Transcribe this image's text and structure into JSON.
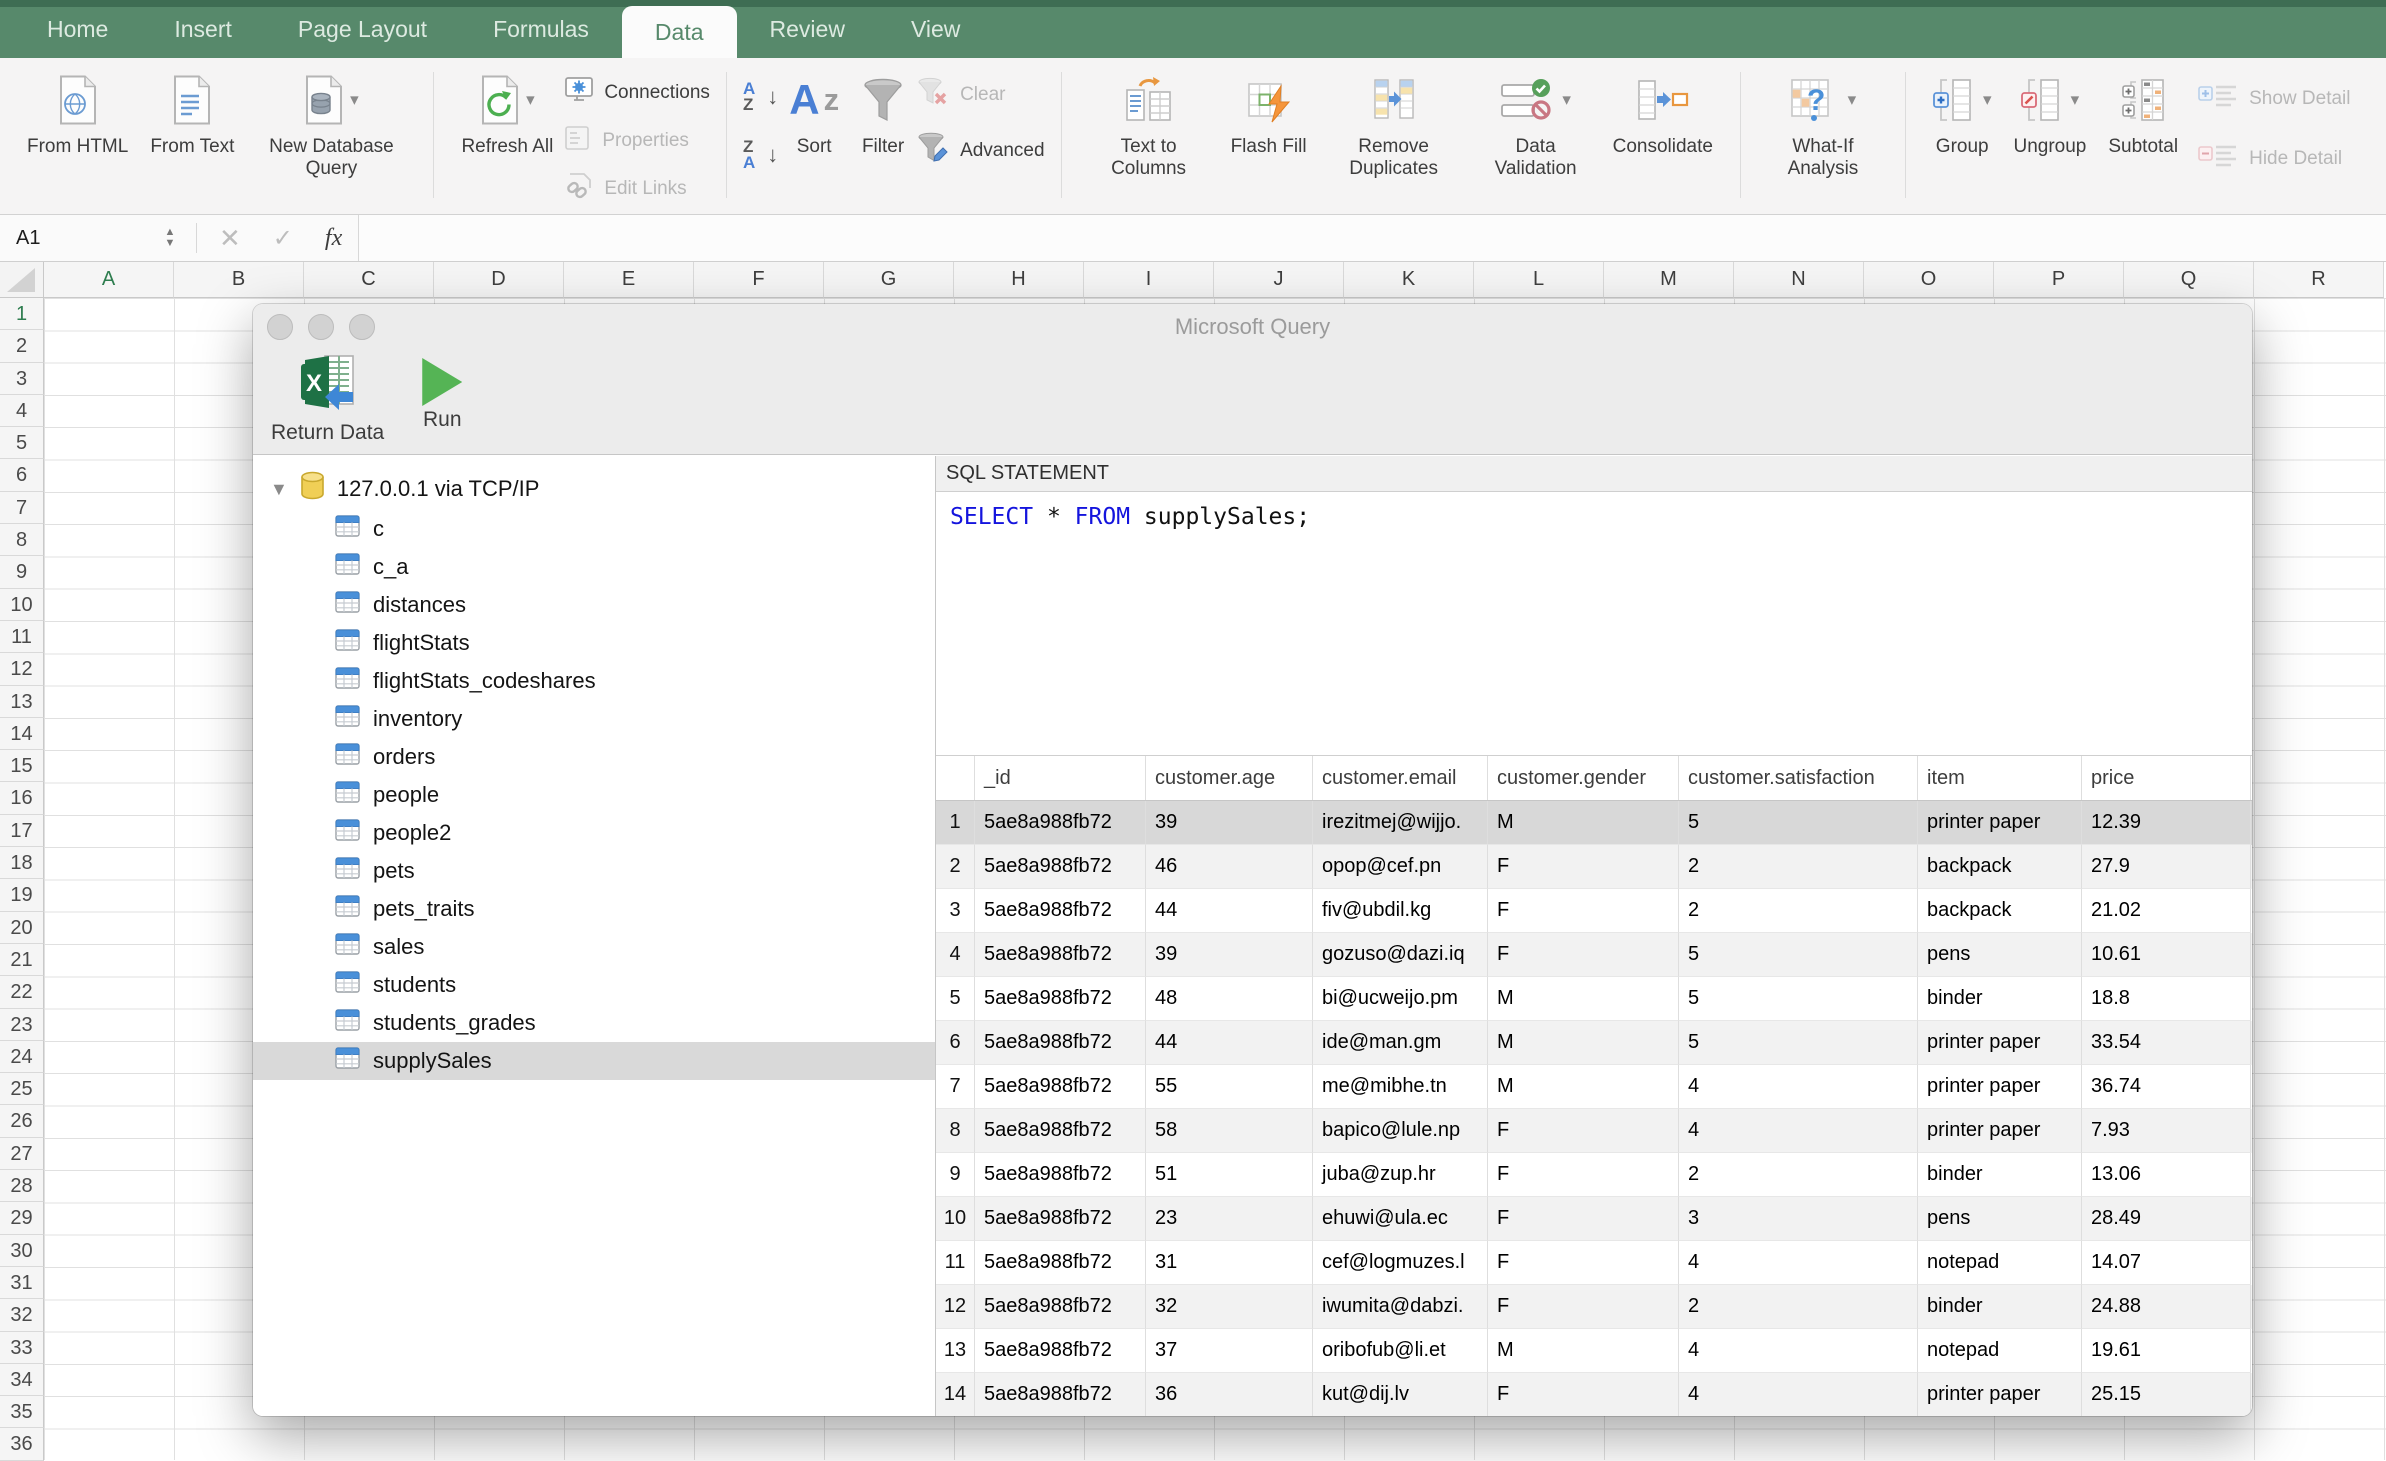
{
  "ribbon": {
    "tabs": [
      "Home",
      "Insert",
      "Page Layout",
      "Formulas",
      "Data",
      "Review",
      "View"
    ],
    "active_tab": "Data",
    "buttons": {
      "from_html": "From HTML",
      "from_text": "From Text",
      "new_database_query": "New Database Query",
      "refresh_all": "Refresh All",
      "connections": "Connections",
      "properties": "Properties",
      "edit_links": "Edit Links",
      "sort": "Sort",
      "filter": "Filter",
      "clear": "Clear",
      "advanced": "Advanced",
      "text_to_columns": "Text to Columns",
      "flash_fill": "Flash Fill",
      "remove_duplicates": "Remove Duplicates",
      "data_validation": "Data Validation",
      "consolidate": "Consolidate",
      "what_if_analysis": "What-If Analysis",
      "group": "Group",
      "ungroup": "Ungroup",
      "subtotal": "Subtotal",
      "show_detail": "Show Detail",
      "hide_detail": "Hide Detail"
    }
  },
  "formula_bar": {
    "name_box": "A1",
    "fx_label": "fx"
  },
  "sheet": {
    "selected_cell": "A1",
    "column_letters": [
      "A",
      "B",
      "C",
      "D",
      "E",
      "F",
      "G",
      "H",
      "I",
      "J",
      "K",
      "L",
      "M",
      "N",
      "O",
      "P",
      "Q",
      "R"
    ],
    "row_numbers": [
      1,
      2,
      3,
      4,
      5,
      6,
      7,
      8,
      9,
      10,
      11,
      12,
      13,
      14,
      15,
      16,
      17,
      18,
      19,
      20,
      21,
      22,
      23,
      24,
      25,
      26,
      27,
      28,
      29,
      30,
      31,
      32,
      33,
      34,
      35,
      36
    ]
  },
  "query_window": {
    "title": "Microsoft Query",
    "toolbar": {
      "return_data": "Return Data",
      "run": "Run"
    },
    "connection": "127.0.0.1 via TCP/IP",
    "tables": [
      "c",
      "c_a",
      "distances",
      "flightStats",
      "flightStats_codeshares",
      "inventory",
      "orders",
      "people",
      "people2",
      "pets",
      "pets_traits",
      "sales",
      "students",
      "students_grades",
      "supplySales"
    ],
    "selected_table": "supplySales",
    "sql": {
      "label": "SQL STATEMENT",
      "keyword_select": "SELECT",
      "asterisk": "*",
      "keyword_from": "FROM",
      "table_ref": "supplySales;"
    },
    "results": {
      "columns": [
        "_id",
        "customer.age",
        "customer.email",
        "customer.gender",
        "customer.satisfaction",
        "item",
        "price"
      ],
      "rows": [
        [
          "5ae8a988fb72",
          "39",
          "irezitmej@wijjo.",
          "M",
          "5",
          "printer paper",
          "12.39"
        ],
        [
          "5ae8a988fb72",
          "46",
          "opop@cef.pn",
          "F",
          "2",
          "backpack",
          "27.9"
        ],
        [
          "5ae8a988fb72",
          "44",
          "fiv@ubdil.kg",
          "F",
          "2",
          "backpack",
          "21.02"
        ],
        [
          "5ae8a988fb72",
          "39",
          "gozuso@dazi.iq",
          "F",
          "5",
          "pens",
          "10.61"
        ],
        [
          "5ae8a988fb72",
          "48",
          "bi@ucweijo.pm",
          "M",
          "5",
          "binder",
          "18.8"
        ],
        [
          "5ae8a988fb72",
          "44",
          "ide@man.gm",
          "M",
          "5",
          "printer paper",
          "33.54"
        ],
        [
          "5ae8a988fb72",
          "55",
          "me@mibhe.tn",
          "M",
          "4",
          "printer paper",
          "36.74"
        ],
        [
          "5ae8a988fb72",
          "58",
          "bapico@lule.np",
          "F",
          "4",
          "printer paper",
          "7.93"
        ],
        [
          "5ae8a988fb72",
          "51",
          "juba@zup.hr",
          "F",
          "2",
          "binder",
          "13.06"
        ],
        [
          "5ae8a988fb72",
          "23",
          "ehuwi@ula.ec",
          "F",
          "3",
          "pens",
          "28.49"
        ],
        [
          "5ae8a988fb72",
          "31",
          "cef@logmuzes.l",
          "F",
          "4",
          "notepad",
          "14.07"
        ],
        [
          "5ae8a988fb72",
          "32",
          "iwumita@dabzi.",
          "F",
          "2",
          "binder",
          "24.88"
        ],
        [
          "5ae8a988fb72",
          "37",
          "oribofub@li.et",
          "M",
          "4",
          "notepad",
          "19.61"
        ],
        [
          "5ae8a988fb72",
          "36",
          "kut@dij.lv",
          "F",
          "4",
          "printer paper",
          "25.15"
        ]
      ],
      "selected_row": 1
    }
  },
  "colors": {
    "ribbon_green": "#57896B",
    "tabbar_top_strip": "#3e6d53",
    "header_selected_green": "#2e7d4f",
    "sql_keyword_blue": "#1414dd",
    "selected_row_gray": "#d8d8d8",
    "stripe_gray": "#f2f2f2",
    "excel_logo_green": "#1e7145",
    "run_green": "#55b455",
    "arrow_blue": "#3e87d6"
  }
}
